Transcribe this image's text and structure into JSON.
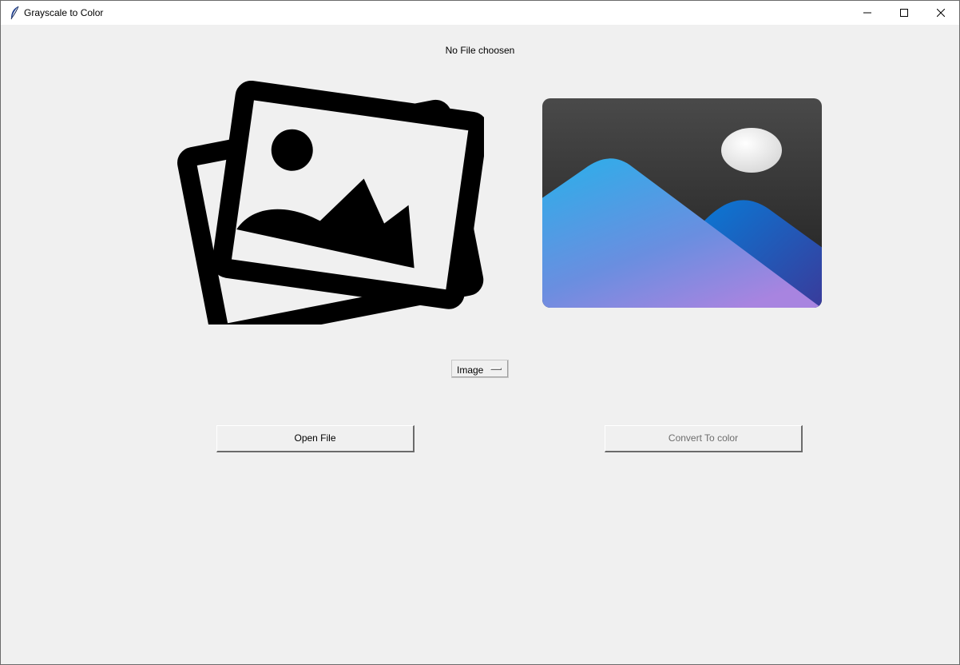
{
  "window": {
    "title": "Grayscale to Color",
    "icon": "feather-icon",
    "controls": [
      "minimize-icon",
      "maximize-icon",
      "close-icon"
    ]
  },
  "status": {
    "text": "No File choosen"
  },
  "images": {
    "left": {
      "icon": "photos-placeholder-icon"
    },
    "right": {
      "icon": "landscape-photo-icon"
    }
  },
  "mode_select": {
    "selected": "Image"
  },
  "buttons": {
    "open_file": "Open File",
    "convert": "Convert To color",
    "convert_disabled": true
  },
  "colors": {
    "background": "#f0f0f0",
    "titlebar": "#ffffff",
    "disabled_text": "#6d6d6d"
  }
}
